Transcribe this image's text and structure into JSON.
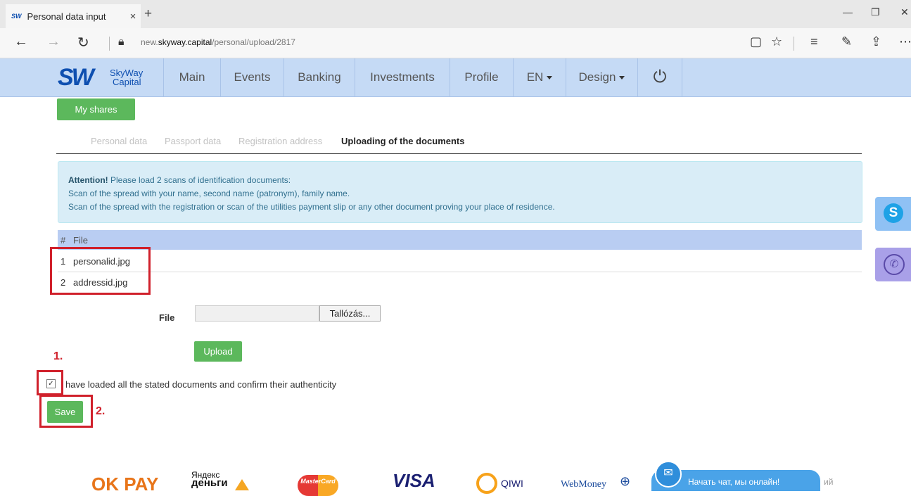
{
  "browser": {
    "tab_title": "Personal data input",
    "favicon": "SW",
    "tab_close": "×",
    "new_tab": "+",
    "url_prefix": "new.",
    "url_domain": "skyway.capital",
    "url_path": "/personal/upload/2817"
  },
  "logo": {
    "mark": "SW",
    "line1": "SkyWay",
    "line2": "Capital"
  },
  "nav": {
    "items": [
      "Main",
      "Events",
      "Banking",
      "Investments",
      "Profile",
      "EN",
      "Design"
    ],
    "power": "⏻"
  },
  "buttons": {
    "my_shares": "My shares",
    "upload": "Upload",
    "save": "Save"
  },
  "steps": [
    "Personal data",
    "Passport data",
    "Registration address",
    "Uploading of the documents"
  ],
  "alert": {
    "strong": "Attention!",
    "line1": " Please load 2 scans of identification documents:",
    "line2": "Scan of the spread with your name, second name (patronym), family name.",
    "line3": "Scan of the spread with the registration or scan of the utilities payment slip or any other document proving your place of residence."
  },
  "table": {
    "header_num": "#",
    "header_file": "File",
    "rows": [
      {
        "num": "1",
        "file": "personalid.jpg"
      },
      {
        "num": "2",
        "file": "addressid.jpg"
      }
    ]
  },
  "file_field": {
    "label": "File",
    "browse": "Tallózás..."
  },
  "confirm": {
    "text": "have loaded all the stated documents and confirm their authenticity",
    "checked": true
  },
  "annotations": {
    "one": "1.",
    "two": "2."
  },
  "footer": {
    "okpay": "OK PAY",
    "yandex1": "Яндекс",
    "yandex2": "деньги",
    "mastercard": "MasterCard",
    "visa": "VISA",
    "qiwi": "QIWI",
    "webmoney": "WebMoney",
    "chat": "Начать чат, мы онлайн!",
    "partial": "ий"
  },
  "colors": {
    "nav_bg": "#c5daf5",
    "green": "#5cb85c",
    "annotation_red": "#d0202b",
    "table_header": "#b9cdf2"
  }
}
